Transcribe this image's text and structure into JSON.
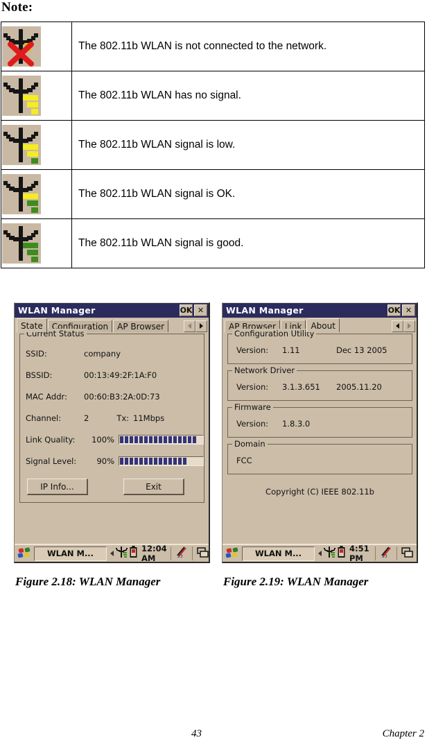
{
  "note": {
    "heading": "Note:",
    "rows": [
      {
        "icon": "wlan-antenna-disconnected-icon",
        "text": "The 802.11b WLAN is not connected to the network."
      },
      {
        "icon": "wlan-antenna-no-signal-icon",
        "text": "The 802.11b WLAN has no signal."
      },
      {
        "icon": "wlan-antenna-low-signal-icon",
        "text": "The 802.11b WLAN signal is low."
      },
      {
        "icon": "wlan-antenna-ok-signal-icon",
        "text": "The 802.11b WLAN signal is OK."
      },
      {
        "icon": "wlan-antenna-good-signal-icon",
        "text": "The 802.11b WLAN signal is good."
      }
    ]
  },
  "colors": {
    "icon_background": "#c9b8a3",
    "icon_antenna": "#151515",
    "signal_yellow": "#f5ec21",
    "signal_green": "#3f8c1e",
    "titlebar": "#2b2b5e",
    "dialog_face": "#cbbda8",
    "meter_fill": "#33337a",
    "cross_red": "#e01b1b"
  },
  "dialog_state": {
    "title": "WLAN Manager",
    "ok_label": "OK",
    "close_label": "✕",
    "tabs": [
      {
        "label": "State",
        "active": true
      },
      {
        "label": "Configuration",
        "active": false
      },
      {
        "label": "AP Browser",
        "active": false
      }
    ],
    "group_title": "Current Status",
    "fields": [
      {
        "label": "SSID:",
        "value": "company"
      },
      {
        "label": "BSSID:",
        "value": "00:13:49:2F:1A:F0"
      },
      {
        "label": "MAC Addr:",
        "value": "00:60:B3:2A:0D:73"
      }
    ],
    "channel": {
      "label": "Channel:",
      "value": "2",
      "tx_label": "Tx:",
      "tx_value": "11Mbps"
    },
    "link_quality": {
      "label": "Link Quality:",
      "percent": "100%",
      "value": 100,
      "segments": 16
    },
    "signal_level": {
      "label": "Signal Level:",
      "percent": "90%",
      "value": 90,
      "segments": 14
    },
    "buttons": {
      "ip_info": "IP Info...",
      "exit": "Exit"
    },
    "taskbar": {
      "task_label": "WLAN M...",
      "clock": "12:04 AM",
      "start_icon": "windows-start-icon",
      "signal_icon": "wlan-antenna-tray-icon",
      "battery_icon": "battery-icon",
      "input_icon": "input-panel-icon",
      "desktop_icon": "desktop-switcher-icon"
    }
  },
  "dialog_about": {
    "title": "WLAN Manager",
    "ok_label": "OK",
    "close_label": "✕",
    "tabs": [
      {
        "label": "AP Browser",
        "active": false
      },
      {
        "label": "Link",
        "active": false
      },
      {
        "label": "About",
        "active": true
      }
    ],
    "groups": [
      {
        "title": "Configuration Utility",
        "row": {
          "label": "Version:",
          "value": "1.11",
          "extra": "Dec 13 2005"
        }
      },
      {
        "title": "Network Driver",
        "row": {
          "label": "Version:",
          "value": "3.1.3.651",
          "extra": "2005.11.20"
        }
      },
      {
        "title": "Firmware",
        "row": {
          "label": "Version:",
          "value": "1.8.3.0",
          "extra": ""
        }
      },
      {
        "title": "Domain",
        "row": {
          "label": "FCC",
          "value": "",
          "extra": ""
        }
      }
    ],
    "copyright": "Copyright (C)  IEEE  802.11b",
    "taskbar": {
      "task_label": "WLAN M...",
      "clock": "4:51 PM",
      "start_icon": "windows-start-icon",
      "signal_icon": "wlan-antenna-tray-icon",
      "battery_icon": "battery-icon",
      "input_icon": "input-panel-icon",
      "desktop_icon": "desktop-switcher-icon"
    }
  },
  "captions": {
    "left": "Figure 2.18: WLAN Manager",
    "right": "Figure 2.19: WLAN Manager"
  },
  "footer": {
    "page": "43",
    "chapter": "Chapter 2"
  }
}
